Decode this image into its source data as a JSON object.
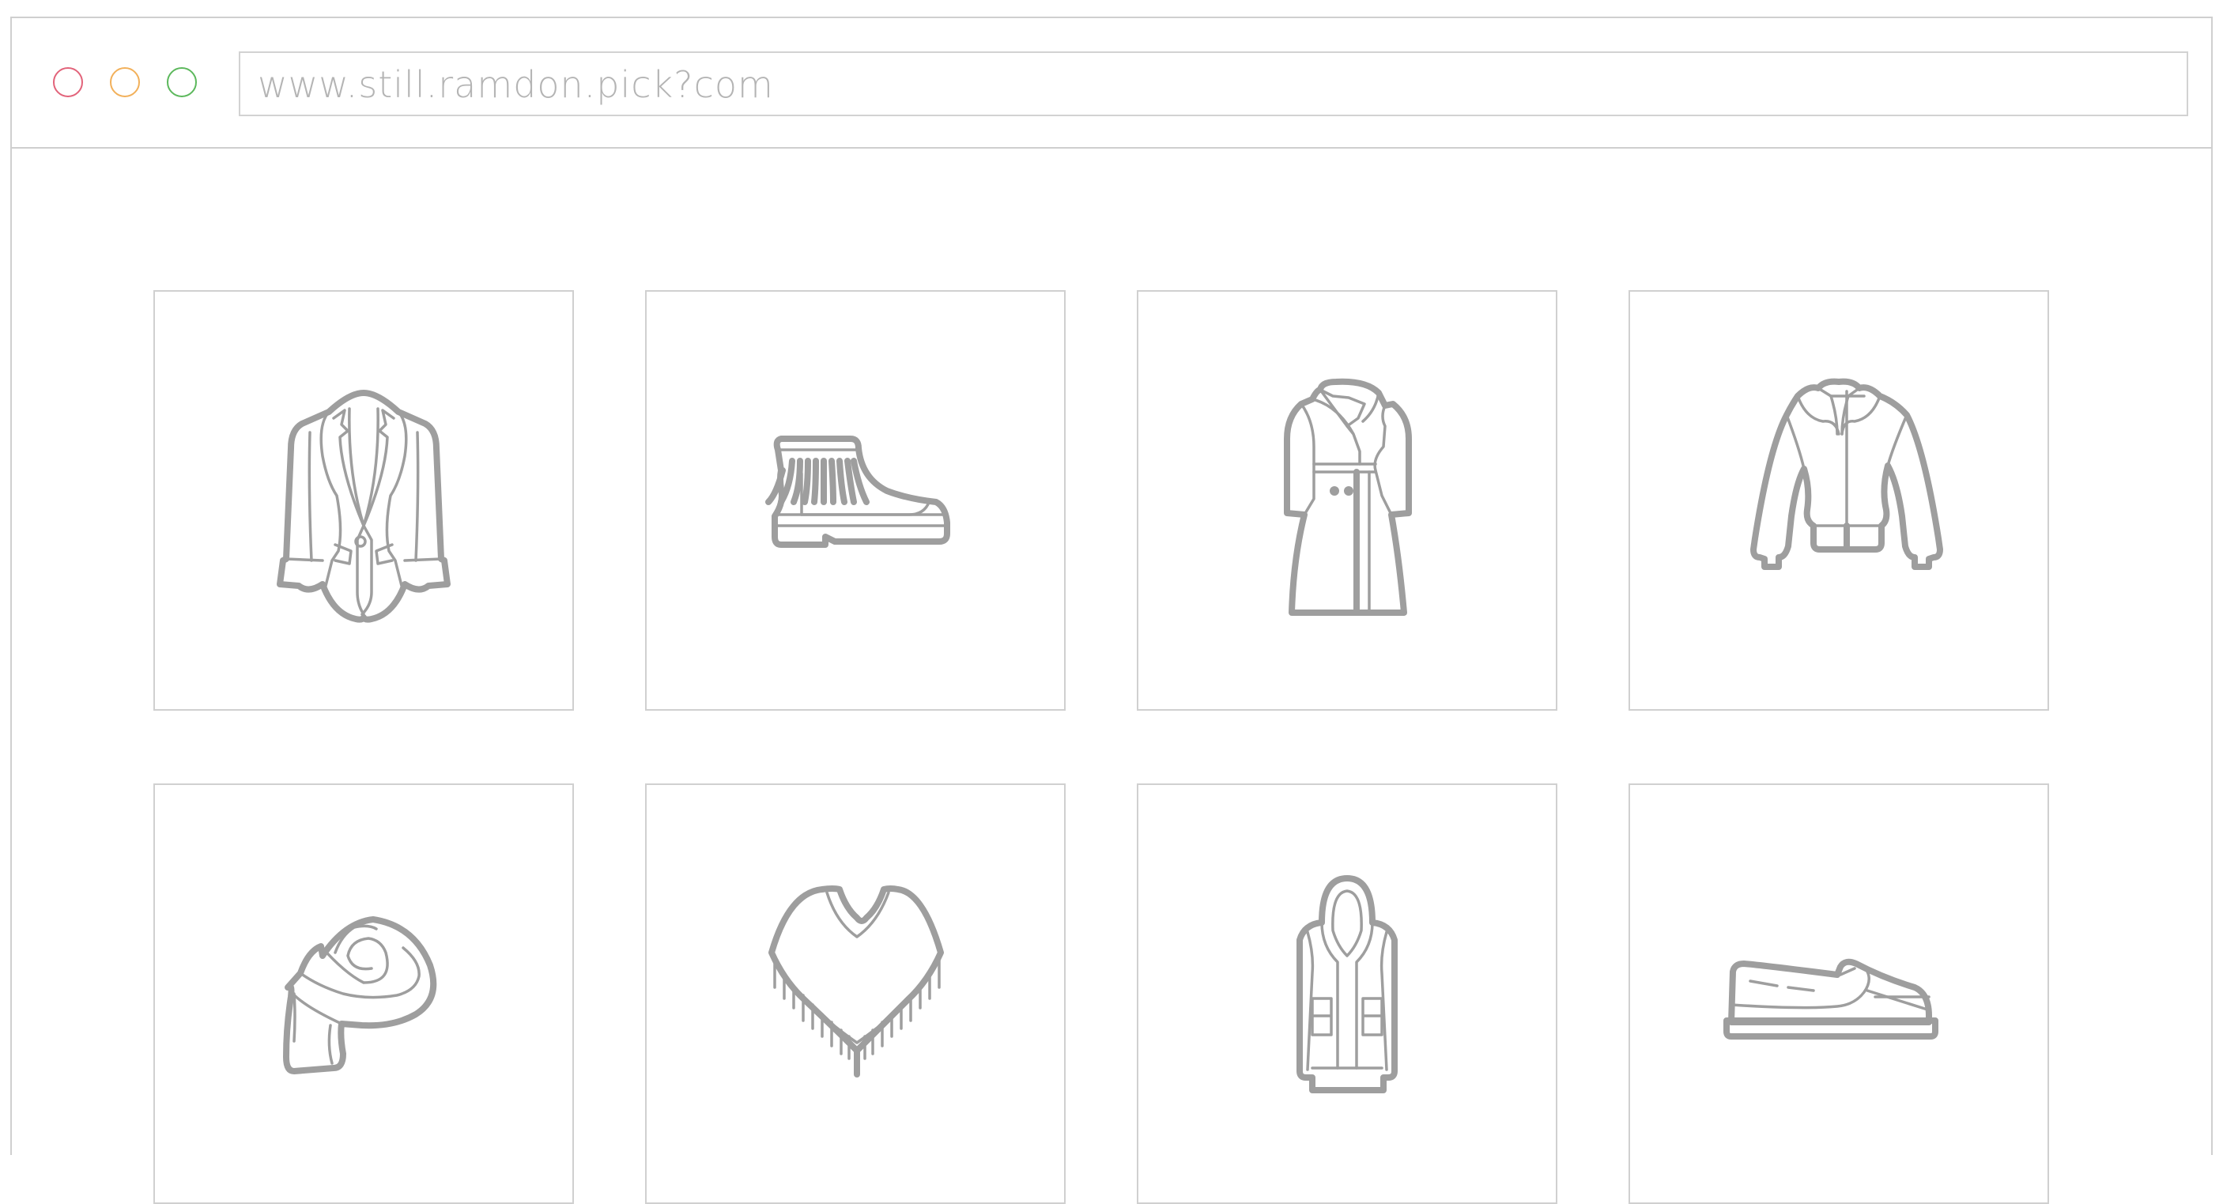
{
  "browser": {
    "url": "www.still.ramdon.pick?com",
    "controls": {
      "close": {
        "color": "#e2637a"
      },
      "minimize": {
        "color": "#f2b05a"
      },
      "maximize": {
        "color": "#5cb85c"
      }
    }
  },
  "grid": {
    "icon_color": "#9e9e9e",
    "items": [
      {
        "icon": "blazer-icon"
      },
      {
        "icon": "fringe-boot-icon"
      },
      {
        "icon": "trench-coat-icon"
      },
      {
        "icon": "bomber-jacket-icon"
      },
      {
        "icon": "scarf-icon"
      },
      {
        "icon": "poncho-icon"
      },
      {
        "icon": "hooded-parka-icon"
      },
      {
        "icon": "loafer-shoe-icon"
      }
    ]
  }
}
